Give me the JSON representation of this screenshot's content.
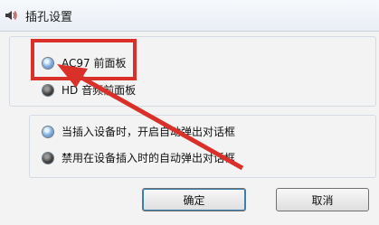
{
  "window": {
    "title": "插孔设置",
    "icon": "speaker-icon"
  },
  "front_panel_group": {
    "options": [
      {
        "label": "AC97 前面板",
        "selected": true
      },
      {
        "label": "HD 音频前面板",
        "selected": false
      }
    ]
  },
  "auto_popup_group": {
    "options": [
      {
        "label": "当插入设备时，开启自动弹出对话框",
        "selected": true
      },
      {
        "label": "禁用在设备插入时的自动弹出对话框",
        "selected": false
      }
    ]
  },
  "buttons": {
    "ok": "确定",
    "cancel": "取消"
  },
  "annotation": {
    "color": "#d9302a"
  }
}
